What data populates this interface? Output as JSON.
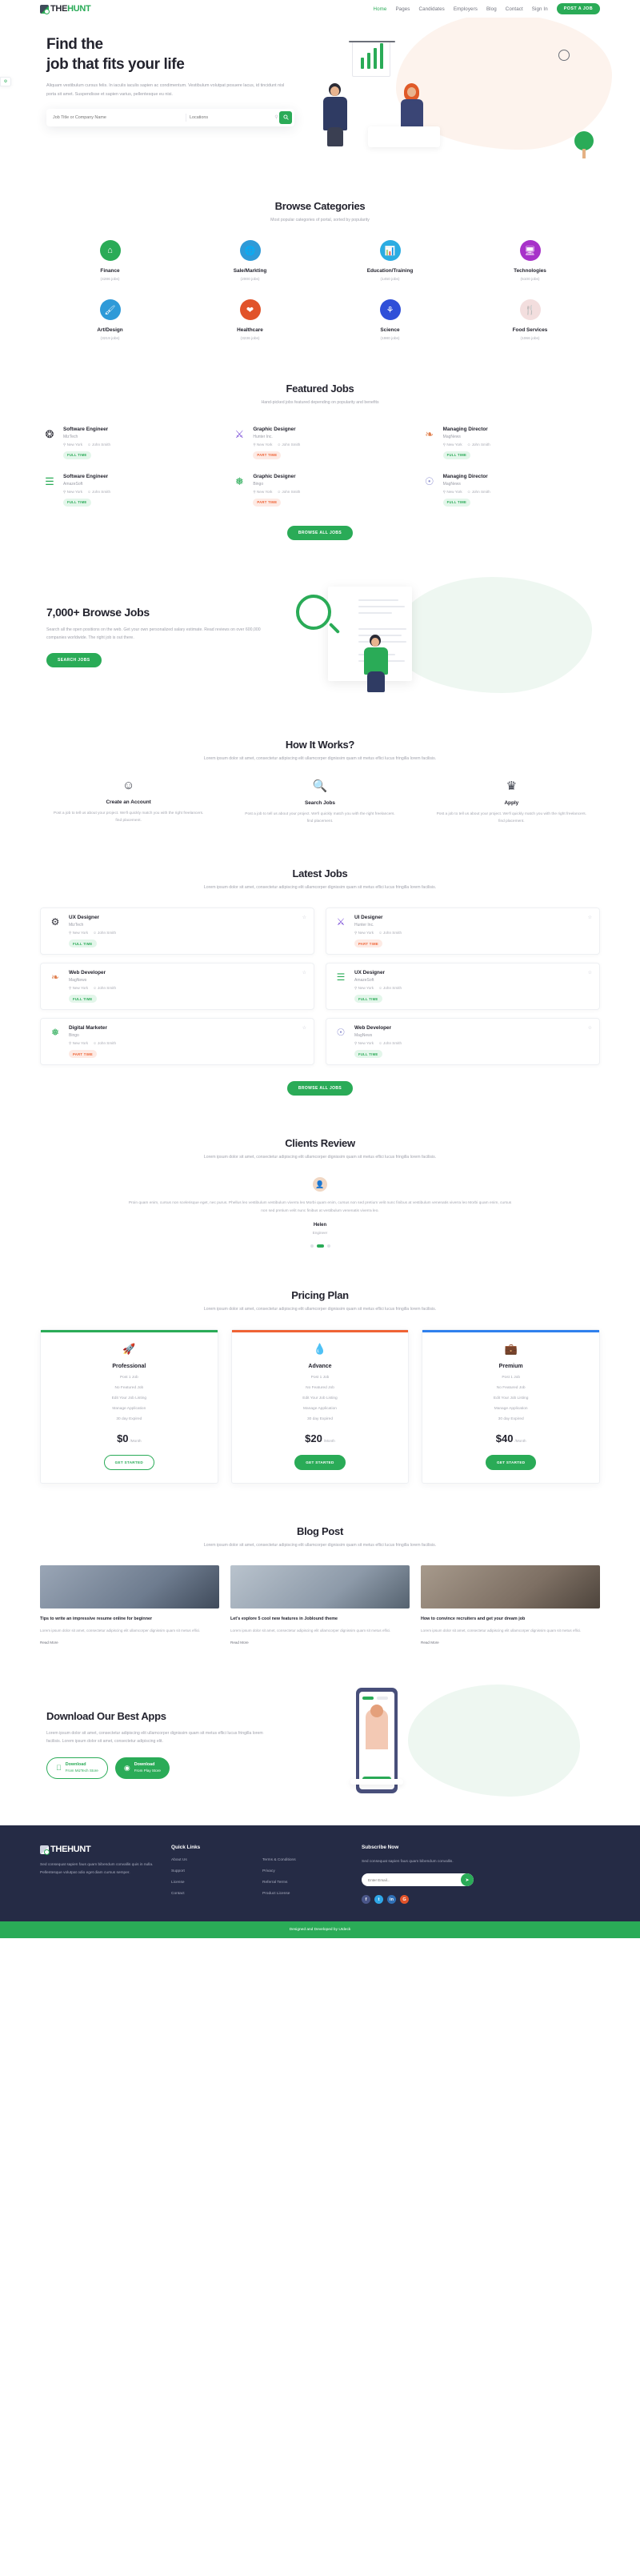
{
  "brand": {
    "name_part1": "THE",
    "name_part2": "HUNT",
    "accent": "#2aab57",
    "dark": "#252b45"
  },
  "header": {
    "nav": [
      {
        "label": "Home",
        "active": true
      },
      {
        "label": "Pages",
        "active": false
      },
      {
        "label": "Candidates",
        "active": false
      },
      {
        "label": "Employers",
        "active": false
      },
      {
        "label": "Blog",
        "active": false
      },
      {
        "label": "Contact",
        "active": false
      },
      {
        "label": "Sign In",
        "active": false
      }
    ],
    "cta": "POST A JOB"
  },
  "hero": {
    "title_line1": "Find the",
    "title_line2": "job that fits your life",
    "description": "Aliquam vestibulum cursus felis. In iaculis iaculis sapien ac condimentum. Vestibulum volutpat posuere lacus, id tincidunt nisl porta sit amet. Suspendisse et sapien varius, pellentesque eu nisi.",
    "search_job_placeholder": "Job Title or Company Name",
    "search_location_placeholder": "Locations",
    "search_button_icon": "search-icon"
  },
  "categories": {
    "title": "Browse Categories",
    "subtitle": "Most popular categories of portal, sorted by popularity",
    "items": [
      {
        "name": "Finance",
        "jobs": "(4286 jobs)",
        "color": "#2aab57",
        "icon": "home-icon"
      },
      {
        "name": "Sale/Markting",
        "jobs": "(2000 jobs)",
        "color": "#2e9ad8",
        "icon": "globe-icon"
      },
      {
        "name": "Education/Training",
        "jobs": "(1450 jobs)",
        "color": "#2bace2",
        "icon": "presentation-icon"
      },
      {
        "name": "Technologies",
        "jobs": "(5100 jobs)",
        "color": "#a732c9",
        "icon": "monitor-icon"
      },
      {
        "name": "Art/Design",
        "jobs": "(3219 jobs)",
        "color": "#2e9ad8",
        "icon": "brush-icon"
      },
      {
        "name": "Healthcare",
        "jobs": "(3236 jobs)",
        "color": "#e1532a",
        "icon": "heart-icon"
      },
      {
        "name": "Science",
        "jobs": "(1980 jobs)",
        "color": "#2f4fd8",
        "icon": "flask-icon"
      },
      {
        "name": "Food Services",
        "jobs": "(1066 jobs)",
        "color": "#f5e2e2",
        "icon": "food-icon"
      }
    ]
  },
  "featured": {
    "title": "Featured Jobs",
    "subtitle": "Hand-picked jobs featured depending on popularity and benefits",
    "button": "BROWSE ALL JOBS",
    "jobs": [
      {
        "title": "Software Engineer",
        "company": "MizTech",
        "location": "New York",
        "person": "John Smith",
        "type": "FULL TIME",
        "type_class": "ft",
        "icon": "puzzle-icon",
        "color": "#2b2b35"
      },
      {
        "title": "Graphic Designer",
        "company": "Hunter Inc.",
        "location": "New York",
        "person": "John Smith",
        "type": "PART TIME",
        "type_class": "pt",
        "icon": "ribbon-icon",
        "color": "#7b4fd8"
      },
      {
        "title": "Managing Director",
        "company": "MagNews",
        "location": "New York",
        "person": "John Smith",
        "type": "FULL TIME",
        "type_class": "ft",
        "icon": "leaf-icon",
        "color": "#e0804f"
      },
      {
        "title": "Software Engineer",
        "company": "AmazeSoft",
        "location": "New York",
        "person": "John Smith",
        "type": "FULL TIME",
        "type_class": "ft",
        "icon": "layers-icon",
        "color": "#2aab57"
      },
      {
        "title": "Graphic Designer",
        "company": "Bingo",
        "location": "New York",
        "person": "John Smith",
        "type": "PART TIME",
        "type_class": "pt",
        "icon": "seed-icon",
        "color": "#2aab57"
      },
      {
        "title": "Managing Director",
        "company": "MagNews",
        "location": "New York",
        "person": "John Smith",
        "type": "FULL TIME",
        "type_class": "ft",
        "icon": "balloon-icon",
        "color": "#8d8fd0"
      }
    ]
  },
  "browse": {
    "title": "7,000+ Browse Jobs",
    "description": "Search all the open positions on the web. Get your own personalized salary estimate. Read reviews on over 600,000 companies worldwide. The right job is out there.",
    "button": "SEARCH JOBS"
  },
  "how_it_works": {
    "title": "How It Works?",
    "subtitle": "Lorem ipsum dolor sit amet, consectetur adipiscing elit ullamcorper dignissim quam sit metus eflici lucus fringilla lorem facilisis.",
    "steps": [
      {
        "icon": "user-account-icon",
        "title": "Create an Account",
        "text": "Post a job to tell us about your project. We'll quickly match you with the right freelancers. find placement."
      },
      {
        "icon": "search-jobs-icon",
        "title": "Search Jobs",
        "text": "Post a job to tell us about your project. We'll quickly match you with the right freelancers. find placement."
      },
      {
        "icon": "apply-trophy-icon",
        "title": "Apply",
        "text": "Post a job to tell us about your project. We'll quickly match you with the right freelancers. find placement."
      }
    ]
  },
  "latest": {
    "title": "Latest Jobs",
    "subtitle": "Lorem ipsum dolor sit amet, consectetur adipiscing elit ullamcorper dignissim quam sit metus eflici lucus fringilla lorem facilisis.",
    "button": "BROWSE ALL JOBS",
    "jobs": [
      {
        "title": "UX Designer",
        "company": "MizTech",
        "location": "New York",
        "person": "John Smith",
        "type": "FULL TIME",
        "type_class": "ft",
        "icon": "gear-icon",
        "color": "#2b2b35"
      },
      {
        "title": "UI Designer",
        "company": "Hunter Inc.",
        "location": "New York",
        "person": "John Smith",
        "type": "PART TIME",
        "type_class": "pt",
        "icon": "ribbon-icon",
        "color": "#7b4fd8"
      },
      {
        "title": "Web Developer",
        "company": "MagNews",
        "location": "New York",
        "person": "John Smith",
        "type": "FULL TIME",
        "type_class": "ft",
        "icon": "leaf-icon",
        "color": "#e0804f"
      },
      {
        "title": "UX Designer",
        "company": "AmazeSoft",
        "location": "New York",
        "person": "John Smith",
        "type": "FULL TIME",
        "type_class": "ft",
        "icon": "layers-icon",
        "color": "#2aab57"
      },
      {
        "title": "Digital Marketer",
        "company": "Bingo",
        "location": "New York",
        "person": "John Smith",
        "type": "PART TIME",
        "type_class": "pt",
        "icon": "seed-icon",
        "color": "#2aab57"
      },
      {
        "title": "Web Developer",
        "company": "MagNews",
        "location": "New York",
        "person": "John Smith",
        "type": "FULL TIME",
        "type_class": "ft",
        "icon": "balloon-icon",
        "color": "#8d8fd0"
      }
    ]
  },
  "reviews": {
    "title": "Clients Review",
    "subtitle": "Lorem ipsum dolor sit amet, consectetur adipiscing elit ullamcorper dignissim quam sit metus eflici lucus fringilla lorem facilisis.",
    "quote": "Proin quam enim, cursus non scelerisque eget, nec purus. Phellus leo vestibulum vestibulum viverra leo Morbi quam enim, cursus non sed pretium velit nunc finibus at vestibulum venenatis viverra leo Morbi quam enim, cursus non sed pretium velit nunc finibus at vestibulum venenatis viverra leo.",
    "author": "Helen",
    "role": "Engineer",
    "avatar_icon": "avatar-icon"
  },
  "pricing": {
    "title": "Pricing Plan",
    "subtitle": "Lorem ipsum dolor sit amet, consectetur adipiscing elit ullamcorper dignissim quam sit metus eflici lucus fringilla lorem facilisis.",
    "plans": [
      {
        "icon": "rocket-icon",
        "name": "Professional",
        "features": [
          "Post 1 Job",
          "No Featured Job",
          "Edit Your Job Listing",
          "Manage Application",
          "30 day Expired"
        ],
        "currency": "$",
        "price": "0",
        "per": "/Month",
        "button": "GET STARTED"
      },
      {
        "icon": "drop-icon",
        "name": "Advance",
        "features": [
          "Post 1 Job",
          "No Featured Job",
          "Edit Your Job Listing",
          "Manage Application",
          "30 day Expired"
        ],
        "currency": "$",
        "price": "20",
        "per": "/Month",
        "button": "GET STARTED"
      },
      {
        "icon": "briefcase-icon",
        "name": "Premium",
        "features": [
          "Post 1 Job",
          "No Featured Job",
          "Edit Your Job Listing",
          "Manage Application",
          "30 day Expired"
        ],
        "currency": "$",
        "price": "40",
        "per": "/Month",
        "button": "GET STARTED"
      }
    ]
  },
  "blog": {
    "title": "Blog Post",
    "subtitle": "Lorem ipsum dolor sit amet, consectetur adipiscing elit ullamcorper dignissim quam sit metus eflici lucus fringilla lorem facilisis.",
    "posts": [
      {
        "title": "Tips to write an impressive resume online for beginner",
        "excerpt": "Lorem ipsum dolor sit amet, consectetur adipiscing elit ullamcorper dignissim quam sit metus eflici.",
        "read_more": "Read More"
      },
      {
        "title": "Let's explore 5 cool new features in Joblound theme",
        "excerpt": "Lorem ipsum dolor sit amet, consectetur adipiscing elit ullamcorper dignissim quam sit metus eflici.",
        "read_more": "Read More"
      },
      {
        "title": "How to convince recruiters and get your dream job",
        "excerpt": "Lorem ipsum dolor sit amet, consectetur adipiscing elit ullamcorper dignissim quam sit metus eflici.",
        "read_more": "Read More"
      }
    ]
  },
  "apps": {
    "title": "Download Our Best Apps",
    "description": "Lorem ipsum dolor sit amet, consectetur adipiscing elit ullamcorper dignissim quam sit metus eflici lucus fringilla lorem facilisis. Lorem ipsum dolor sit amet, consectetur adipiscing elit.",
    "store1_small": "Download",
    "store1_big": "From MizTech Store",
    "store1_icon": "apple-icon",
    "store2_small": "Download",
    "store2_big": "From Play Store",
    "store2_icon": "android-icon"
  },
  "footer": {
    "about": "Sed consequat sapien faus quam bibendum convallis quis in nulla. Pellentesque volutpat odio eget diam cursus semper.",
    "quick_links_title": "Quick Links",
    "links_col1": [
      "About Us",
      "Support",
      "License",
      "Contact"
    ],
    "links_col2": [
      "Terms & Conditions",
      "Privacy",
      "Referral Terms",
      "Product License"
    ],
    "subscribe_title": "Subscribe Now",
    "subscribe_text": "Sed consequat sapien faus quam bibendum convallis.",
    "email_placeholder": "Enter Email...",
    "subscribe_icon": "send-icon",
    "socials": [
      {
        "name": "facebook-icon",
        "glyph": "f",
        "color": "#4a5689"
      },
      {
        "name": "twitter-icon",
        "glyph": "t",
        "color": "#2fa7e8"
      },
      {
        "name": "linkedin-icon",
        "glyph": "in",
        "color": "#2f6fb5"
      },
      {
        "name": "google-icon",
        "glyph": "G",
        "color": "#e1532a"
      }
    ],
    "copyright": "Designed and Developed by UIdeck"
  }
}
